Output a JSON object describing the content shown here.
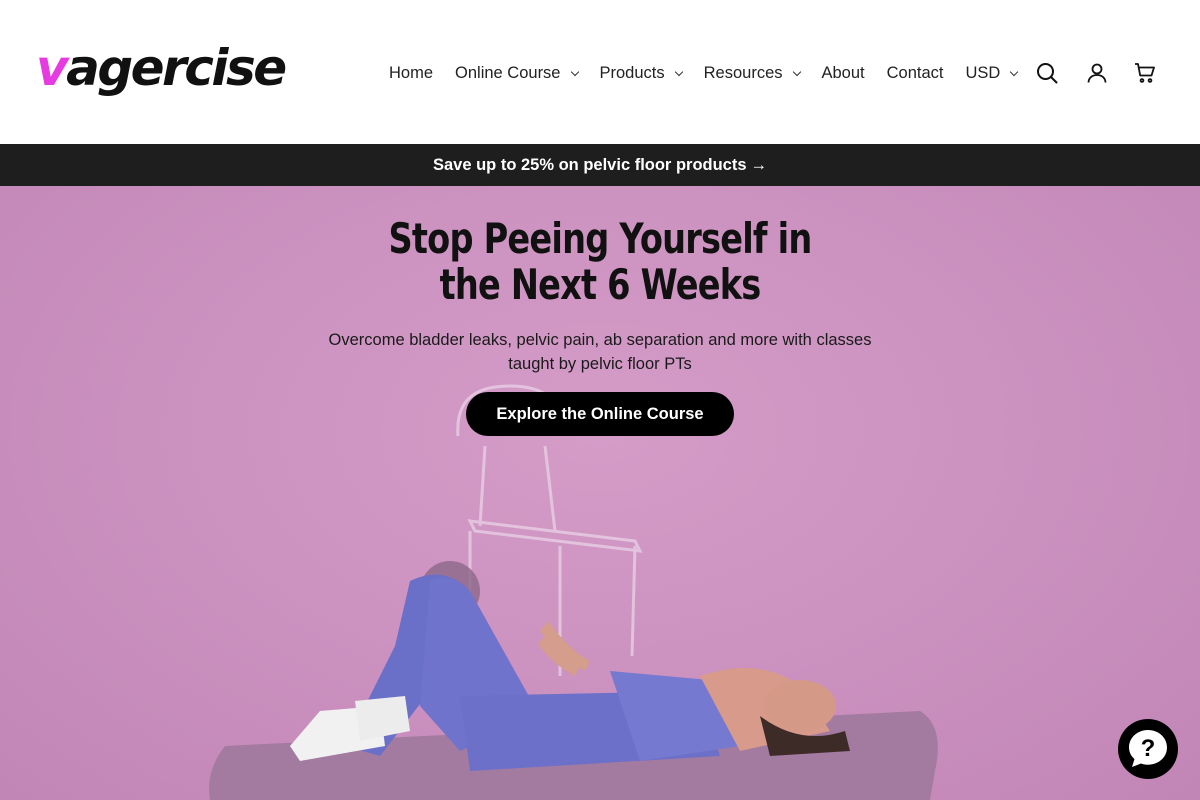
{
  "brand": {
    "logo_first": "v",
    "logo_rest": "agercise",
    "accent_color": "#e63be0"
  },
  "nav": {
    "items": [
      {
        "label": "Home",
        "dropdown": false
      },
      {
        "label": "Online Course",
        "dropdown": true
      },
      {
        "label": "Products",
        "dropdown": true
      },
      {
        "label": "Resources",
        "dropdown": true
      },
      {
        "label": "About",
        "dropdown": false
      },
      {
        "label": "Contact",
        "dropdown": false
      },
      {
        "label": "USD",
        "dropdown": true
      }
    ],
    "icons": [
      "search-icon",
      "account-icon",
      "cart-icon"
    ]
  },
  "promo": {
    "text": "Save up to 25% on pelvic floor products",
    "arrow": "→"
  },
  "hero": {
    "title": "Stop Peeing Yourself in the Next 6 Weeks",
    "subtitle": "Overcome bladder leaks, pelvic pain, ab separation and more with classes taught by pelvic floor PTs",
    "cta_label": "Explore the Online Course"
  },
  "chat": {
    "icon": "chat-help-icon"
  }
}
